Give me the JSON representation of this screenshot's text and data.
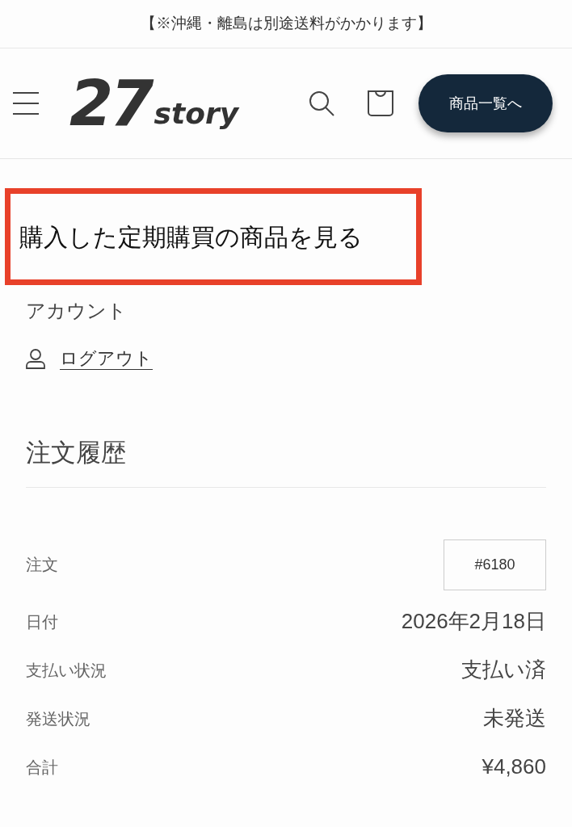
{
  "announcement": "【※沖縄・離島は別途送料がかかります】",
  "header": {
    "logo": {
      "number": "27",
      "word": "story"
    },
    "cta_button": "商品一覧へ"
  },
  "heading": {
    "text": "購入した定期購買の商品を見る",
    "highlighted": true
  },
  "account": {
    "title": "アカウント",
    "logout_link": "ログアウト"
  },
  "order_history": {
    "title": "注文履歴",
    "rows": [
      {
        "label": "注文",
        "value": "#6180",
        "kind": "link"
      },
      {
        "label": "日付",
        "value": "2026年2月18日",
        "kind": "text"
      },
      {
        "label": "支払い状況",
        "value": "支払い済",
        "kind": "text"
      },
      {
        "label": "発送状況",
        "value": "未発送",
        "kind": "text"
      },
      {
        "label": "合計",
        "value": "¥4,860",
        "kind": "text"
      }
    ]
  }
}
